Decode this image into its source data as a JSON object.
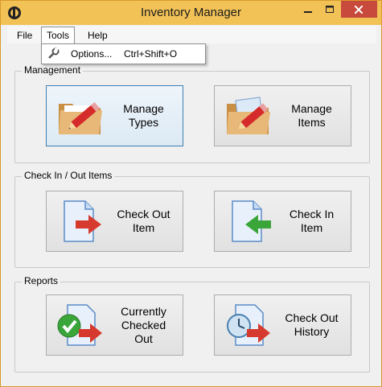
{
  "window": {
    "title": "Inventory Manager"
  },
  "menubar": {
    "file": "File",
    "tools": "Tools",
    "help": "Help"
  },
  "tools_menu": {
    "options_label": "Options...",
    "options_shortcut": "Ctrl+Shift+O"
  },
  "groups": {
    "management": {
      "title": "Management",
      "manage_types": "Manage\nTypes",
      "manage_items": "Manage\nItems"
    },
    "checkinout": {
      "title": "Check In / Out Items",
      "check_out": "Check Out\nItem",
      "check_in": "Check In\nItem"
    },
    "reports": {
      "title": "Reports",
      "currently_checked_out": "Currently\nChecked\nOut",
      "history": "Check Out\nHistory"
    }
  },
  "colors": {
    "titlebar": "#f2c257",
    "close_button": "#c74a3c",
    "focus_border": "#3c7fb1"
  }
}
